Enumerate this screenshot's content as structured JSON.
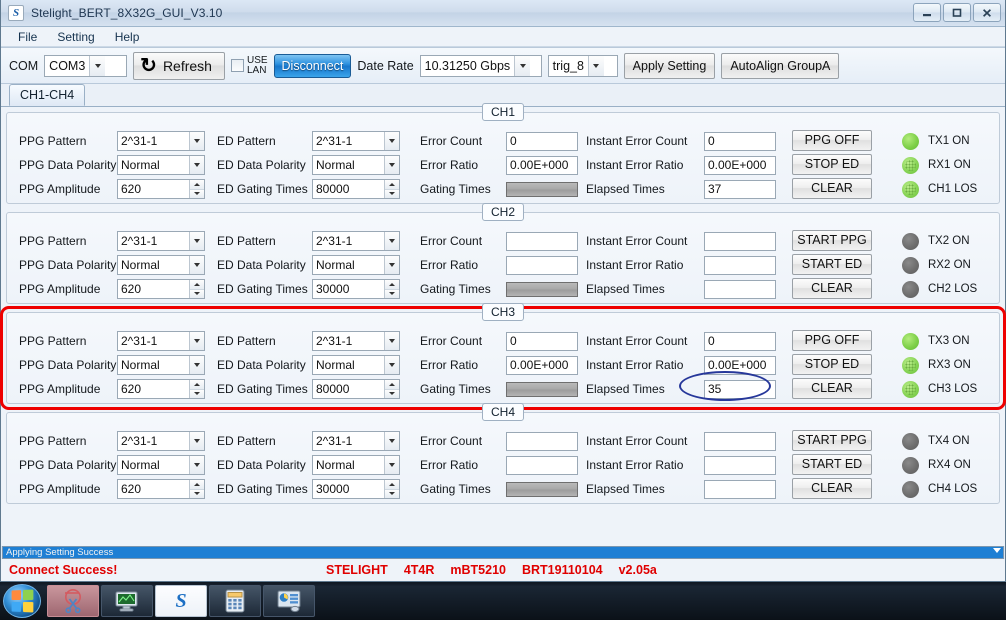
{
  "window": {
    "title": "Stelight_BERT_8X32G_GUI_V3.10",
    "icon": "app-logo-icon",
    "minimize_label": "Minimize",
    "maximize_label": "Maximize",
    "close_label": "Close"
  },
  "menu": {
    "items": [
      {
        "label": "File"
      },
      {
        "label": "Setting"
      },
      {
        "label": "Help"
      }
    ]
  },
  "toolbar": {
    "com_label": "COM",
    "com_value": "COM3",
    "refresh_label": "Refresh",
    "use_lan_line1": "USE",
    "use_lan_line2": "LAN",
    "use_lan_checked": false,
    "disconnect_label": "Disconnect",
    "date_rate_label": "Date Rate",
    "date_rate_value": "10.31250 Gbps",
    "trig_value": "trig_8",
    "apply_setting_label": "Apply Setting",
    "autoalign_label": "AutoAlign GroupA"
  },
  "tabs": [
    {
      "label": "CH1-CH4",
      "selected": true
    }
  ],
  "labels": {
    "ppg_pattern": "PPG Pattern",
    "ppg_data_polarity": "PPG Data Polarity",
    "ppg_amplitude": "PPG Amplitude",
    "ed_pattern": "ED Pattern",
    "ed_data_polarity": "ED Data Polarity",
    "ed_gating_times": "ED Gating Times",
    "error_count": "Error Count",
    "error_ratio": "Error Ratio",
    "gating_times": "Gating Times",
    "instant_error_count": "Instant Error Count",
    "instant_error_ratio": "Instant Error Ratio",
    "elapsed_times": "Elapsed Times"
  },
  "channels": [
    {
      "legend": "CH1",
      "highlighted": false,
      "ppg_pattern": "2^31-1",
      "ppg_data_polarity": "Normal",
      "ppg_amplitude": "620",
      "ed_pattern": "2^31-1",
      "ed_data_polarity": "Normal",
      "ed_gating_times": "80000",
      "error_count": "0",
      "error_ratio": "0.00E+000",
      "gating_times_progress": 100,
      "instant_error_count": "0",
      "instant_error_ratio": "0.00E+000",
      "elapsed_times": "37",
      "buttons": [
        "PPG OFF",
        "STOP ED",
        "CLEAR"
      ],
      "leds": [
        {
          "label": "TX1 ON",
          "state": "on"
        },
        {
          "label": "RX1 ON",
          "state": "on-dot"
        },
        {
          "label": "CH1 LOS",
          "state": "on-dot"
        }
      ]
    },
    {
      "legend": "CH2",
      "highlighted": false,
      "ppg_pattern": "2^31-1",
      "ppg_data_polarity": "Normal",
      "ppg_amplitude": "620",
      "ed_pattern": "2^31-1",
      "ed_data_polarity": "Normal",
      "ed_gating_times": "30000",
      "error_count": "",
      "error_ratio": "",
      "gating_times_progress": 0,
      "instant_error_count": "",
      "instant_error_ratio": "",
      "elapsed_times": "",
      "buttons": [
        "START PPG",
        "START ED",
        "CLEAR"
      ],
      "leds": [
        {
          "label": "TX2 ON",
          "state": "off"
        },
        {
          "label": "RX2 ON",
          "state": "off"
        },
        {
          "label": "CH2 LOS",
          "state": "off"
        }
      ]
    },
    {
      "legend": "CH3",
      "highlighted": true,
      "ppg_pattern": "2^31-1",
      "ppg_data_polarity": "Normal",
      "ppg_amplitude": "620",
      "ed_pattern": "2^31-1",
      "ed_data_polarity": "Normal",
      "ed_gating_times": "80000",
      "error_count": "0",
      "error_ratio": "0.00E+000",
      "gating_times_progress": 100,
      "instant_error_count": "0",
      "instant_error_ratio": "0.00E+000",
      "elapsed_times": "35",
      "buttons": [
        "PPG OFF",
        "STOP ED",
        "CLEAR"
      ],
      "leds": [
        {
          "label": "TX3 ON",
          "state": "on"
        },
        {
          "label": "RX3 ON",
          "state": "on-dot"
        },
        {
          "label": "CH3 LOS",
          "state": "on-dot"
        }
      ]
    },
    {
      "legend": "CH4",
      "highlighted": false,
      "ppg_pattern": "2^31-1",
      "ppg_data_polarity": "Normal",
      "ppg_amplitude": "620",
      "ed_pattern": "2^31-1",
      "ed_data_polarity": "Normal",
      "ed_gating_times": "30000",
      "error_count": "",
      "error_ratio": "",
      "gating_times_progress": 0,
      "instant_error_count": "",
      "instant_error_ratio": "",
      "elapsed_times": "",
      "buttons": [
        "START PPG",
        "START ED",
        "CLEAR"
      ],
      "leds": [
        {
          "label": "TX4 ON",
          "state": "off"
        },
        {
          "label": "RX4 ON",
          "state": "off"
        },
        {
          "label": "CH4 LOS",
          "state": "off"
        }
      ]
    }
  ],
  "annotation": {
    "shape": "ellipse",
    "color": "#26379a",
    "target": "CH3 Elapsed Times"
  },
  "status": {
    "bar_text": "Applying Setting Success",
    "bar_color": "#1e7fd4",
    "connect_text": "Connect Success!",
    "connect_color": "#e00000",
    "device_fields": [
      "STELIGHT",
      "4T4R",
      "mBT5210",
      "BRT19110104",
      "v2.05a"
    ]
  },
  "taskbar": {
    "start_label": "Start",
    "items": [
      {
        "name": "snipping-tool",
        "label": "Snipping Tool"
      },
      {
        "name": "display-monitor",
        "label": "Display"
      },
      {
        "name": "stelight-app",
        "label": "Stelight BERT GUI"
      },
      {
        "name": "calculator",
        "label": "Calculator"
      },
      {
        "name": "control-panel",
        "label": "Control Panel"
      }
    ]
  }
}
